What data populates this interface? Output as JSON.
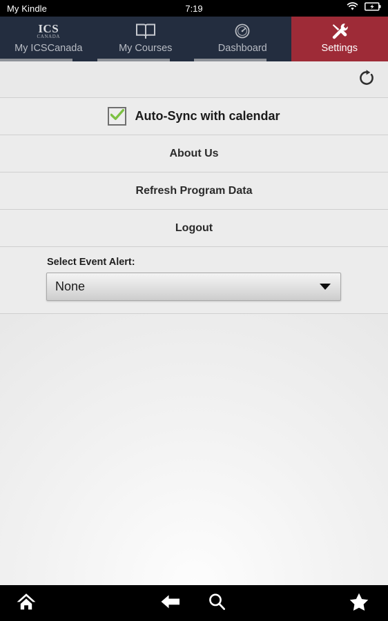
{
  "statusbar": {
    "device_label": "My Kindle",
    "clock": "7:19",
    "wifi_icon": "wifi-icon",
    "battery_icon": "battery-charging-icon"
  },
  "tabs": [
    {
      "label": "My ICSCanada",
      "icon": "ics-canada-logo-icon",
      "logo_primary": "ICS",
      "logo_secondary": "CANADA",
      "active": false
    },
    {
      "label": "My Courses",
      "icon": "open-book-icon",
      "active": false
    },
    {
      "label": "Dashboard",
      "icon": "gauge-icon",
      "active": false
    },
    {
      "label": "Settings",
      "icon": "tools-icon",
      "active": true
    }
  ],
  "toolbar": {
    "refresh_icon": "refresh-icon"
  },
  "autosync": {
    "label": "Auto-Sync with calendar",
    "checked": true,
    "check_icon": "check-icon",
    "check_color": "#7cc142"
  },
  "menu_rows": [
    {
      "label": "About Us"
    },
    {
      "label": "Refresh Program Data"
    },
    {
      "label": "Logout"
    }
  ],
  "event_alert": {
    "label": "Select Event Alert:",
    "selected": "None",
    "caret_icon": "chevron-down-icon"
  },
  "navbar": {
    "home_icon": "home-icon",
    "back_icon": "back-arrow-icon",
    "search_icon": "search-icon",
    "star_icon": "star-icon"
  },
  "colors": {
    "tabbar_bg": "#232d3f",
    "active_tab_bg": "#9e2b37",
    "panel_bg": "#ececec",
    "accent_green": "#7cc142"
  }
}
